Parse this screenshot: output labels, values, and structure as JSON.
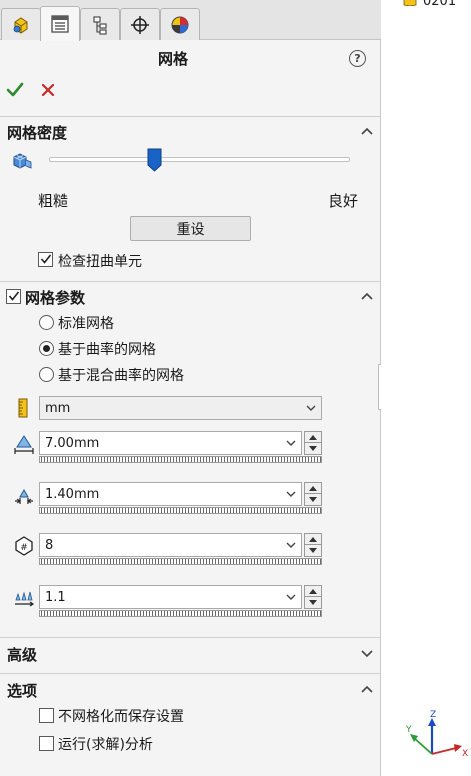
{
  "panel": {
    "title": "网格",
    "density_section": {
      "title": "网格密度",
      "coarse_label": "粗糙",
      "fine_label": "良好",
      "slider_level": 0.35,
      "reset_button": "重设",
      "distorted_checkbox_label": "检查扭曲单元",
      "distorted_checked": true
    },
    "params_section": {
      "title": "网格参数",
      "checked": true,
      "radio_options": [
        "标准网格",
        "基于曲率的网格",
        "基于混合曲率的网格"
      ],
      "selected_index": 1,
      "unit": "mm",
      "fields": [
        {
          "icon": "max-element-size-icon",
          "value": "7.00mm"
        },
        {
          "icon": "min-element-size-icon",
          "value": "1.40mm"
        },
        {
          "icon": "min-elements-circle-icon",
          "value": "8"
        },
        {
          "icon": "growth-ratio-icon",
          "value": "1.1"
        }
      ]
    },
    "advanced_section": {
      "title": "高级"
    },
    "options_section": {
      "title": "选项",
      "checkboxes": [
        "不网格化而保存设置",
        "运行(求解)分析"
      ]
    }
  },
  "tree": {
    "label": "0201"
  },
  "triad": {
    "z_label": "Z",
    "y_label": "Y",
    "x_label": "X"
  },
  "colors": {
    "accent_blue": "#1a63c6",
    "ok_green": "#2f8a2f",
    "cancel_red": "#c62828",
    "panel_bg": "#f4f4f4"
  }
}
